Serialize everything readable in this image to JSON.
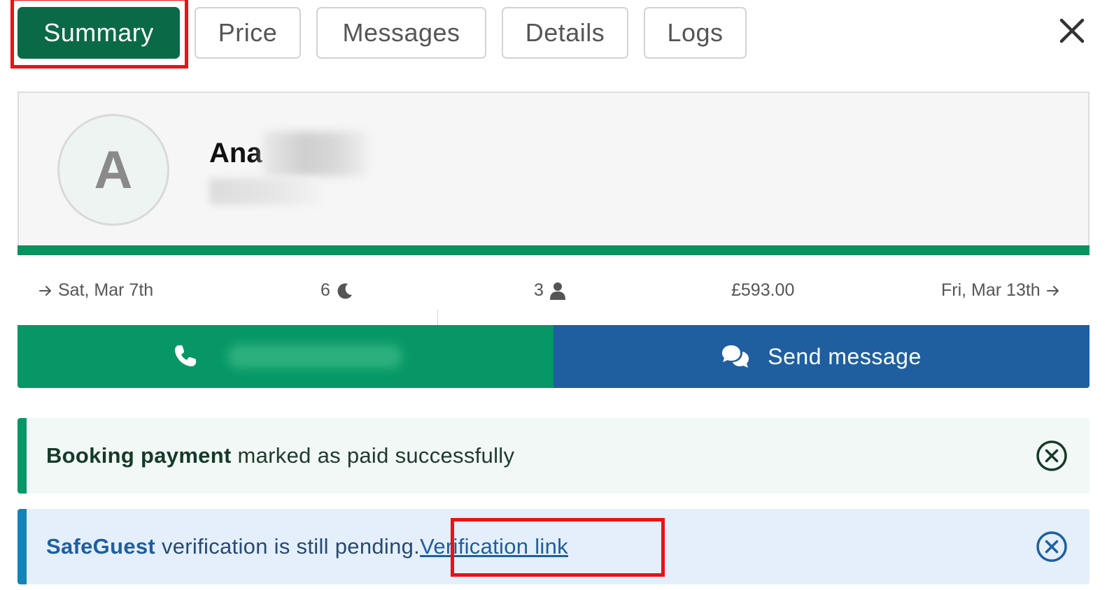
{
  "tabs": [
    {
      "label": "Summary",
      "active": true
    },
    {
      "label": "Price",
      "active": false
    },
    {
      "label": "Messages",
      "active": false
    },
    {
      "label": "Details",
      "active": false
    },
    {
      "label": "Logs",
      "active": false
    }
  ],
  "guest": {
    "avatar_initial": "A",
    "name": "Ana"
  },
  "booking": {
    "check_in": "Sat, Mar 7th",
    "nights": "6",
    "guests": "3",
    "price": "£593.00",
    "check_out": "Fri, Mar 13th"
  },
  "actions": {
    "send_message_label": "Send message"
  },
  "alerts": {
    "payment": {
      "bold": "Booking payment",
      "text": " marked as paid successfully"
    },
    "verification": {
      "bold": "SafeGuest",
      "text": " verification is still pending.",
      "link_label": "Verification link"
    }
  },
  "colors": {
    "primary_green": "#0a6a48",
    "action_green": "#079766",
    "action_blue": "#1f5fa0",
    "highlight_red": "#ee1111"
  },
  "icons": [
    "arrow-right-icon",
    "moon-icon",
    "person-icon",
    "phone-icon",
    "chat-bubbles-icon",
    "close-icon",
    "close-circle-icon"
  ]
}
